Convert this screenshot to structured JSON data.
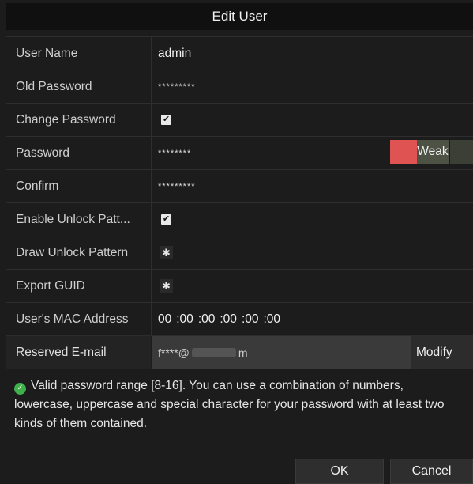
{
  "dialog": {
    "title": "Edit User"
  },
  "form": {
    "user_name": {
      "label": "User Name",
      "value": "admin"
    },
    "old_password": {
      "label": "Old Password",
      "value": "*********"
    },
    "change_password": {
      "label": "Change Password",
      "checked_mark": "✔"
    },
    "password": {
      "label": "Password",
      "value": "********",
      "strength": "Weak"
    },
    "confirm": {
      "label": "Confirm",
      "value": "*********"
    },
    "enable_unlock_pattern": {
      "label": "Enable Unlock Patt...",
      "checked_mark": "✔"
    },
    "draw_unlock_pattern": {
      "label": "Draw Unlock Pattern",
      "icon": "gear-icon"
    },
    "export_guid": {
      "label": "Export GUID",
      "icon": "gear-icon"
    },
    "mac_address": {
      "label": "User's MAC Address",
      "octets": [
        "00",
        ":00",
        ":00",
        ":00",
        ":00",
        ":00"
      ]
    },
    "reserved_email": {
      "label": "Reserved E-mail",
      "value_prefix": "f****@",
      "value_suffix": "m",
      "modify_label": "Modify"
    }
  },
  "info": {
    "icon": "check-circle-icon",
    "text": "Valid password range [8-16]. You can use a combination of numbers, lowercase, uppercase and special character for your password with at least two kinds of them contained."
  },
  "buttons": {
    "ok": "OK",
    "cancel": "Cancel"
  },
  "colors": {
    "strength_weak": "#e05353",
    "check_ok": "#3fb04a"
  }
}
